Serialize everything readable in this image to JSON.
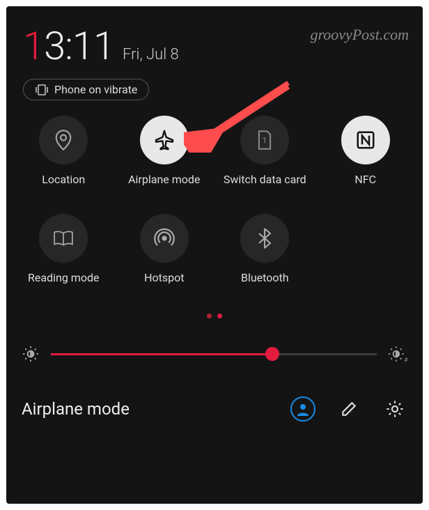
{
  "watermark": "groovyPost.com",
  "time_hour_first": "1",
  "time_rest": "3:11",
  "date": "Fri, Jul 8",
  "vibrate_label": "Phone on vibrate",
  "tiles": [
    {
      "label": "Location",
      "icon": "location-pin-icon",
      "active": false
    },
    {
      "label": "Airplane mode",
      "icon": "airplane-icon",
      "active": true
    },
    {
      "label": "Switch data card",
      "icon": "sim-card-icon",
      "active": false
    },
    {
      "label": "NFC",
      "icon": "nfc-icon",
      "active": true
    },
    {
      "label": "Reading mode",
      "icon": "book-icon",
      "active": false
    },
    {
      "label": "Hotspot",
      "icon": "hotspot-icon",
      "active": false
    },
    {
      "label": "Bluetooth",
      "icon": "bluetooth-icon",
      "active": false
    }
  ],
  "brightness_percent": 68,
  "footer_label": "Airplane mode",
  "colors": {
    "accent": "#e31b3e",
    "bg": "#141414",
    "tile_inactive": "#272727",
    "tile_active": "#e8e8e8",
    "user_ring": "#1a8be5"
  }
}
